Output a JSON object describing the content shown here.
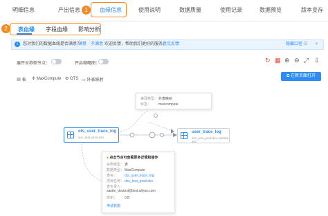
{
  "top_tabs": [
    "明细信息",
    "产出信息",
    "血缘信息",
    "使用说明",
    "数据质量",
    "使用记录",
    "数据预览",
    "版本变存"
  ],
  "active_tab_index": 2,
  "badges": {
    "first": "1",
    "second": "2"
  },
  "sub_tabs": [
    "表血缘",
    "字段血缘",
    "影响分析"
  ],
  "notice": {
    "text": "您对我们的数据血缘是否满意？",
    "satisfied": "满意",
    "unsatisfied": "不满意",
    "suggest": "欢迎反馈，帮助我们更好的服务。",
    "feedback": "意见反馈",
    "close": "稳藏口徑 ⊙"
  },
  "toggles": {
    "expand_label": "展开对称侧节点：",
    "thumbnail_label": "开启缩略图："
  },
  "legend": [
    "表",
    "MaxCompute",
    "OTS",
    "外表映射"
  ],
  "open_button": "在新页面打开",
  "nodes": {
    "source": {
      "name": "ots_user_trace_log",
      "sub": "doc_test_prod.dev"
    },
    "target": {
      "name": "user_trace_log",
      "sub": "doc_test_prod.dev  sanitize doc"
    }
  },
  "top_card": {
    "rows": [
      [
        "来源类型：",
        "外表映射"
      ],
      [
        "标签：",
        "maxcompute"
      ]
    ]
  },
  "bottom_card": {
    "title": "点击节点可查看更多详情和操作",
    "rows": [
      [
        "实例类型：",
        "表"
      ],
      [
        "数据类型：",
        "MaxCompute"
      ],
      [
        "表名：",
        "ots_user_trace_log"
      ],
      [
        "项目名称：",
        "doc_test_prod.dev"
      ],
      [
        "表负责人：",
        "santie_doctest@test.aliyun.com"
      ],
      [
        "体积：",
        "0 B"
      ]
    ],
    "link": "申请权限"
  },
  "colors": {
    "accent": "#2d8cf0",
    "highlight": "#f28b22"
  }
}
